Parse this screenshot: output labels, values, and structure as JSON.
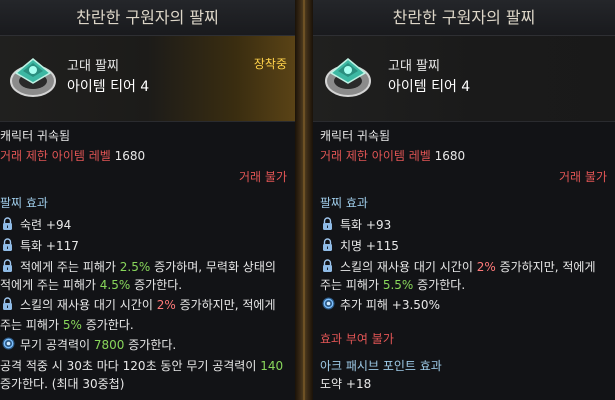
{
  "left": {
    "title": "찬란한 구원자의 팔찌",
    "grade": "고대 팔찌",
    "tier": "아이템 티어 4",
    "equipped": "장착중",
    "bound": "캐릭터 귀속됨",
    "trade_label": "거래 제한 아이템 레벨",
    "trade_value": "1680",
    "trade_status": "거래 불가",
    "section": "팔찌 효과",
    "effects": [
      {
        "text": "숙련 +94"
      },
      {
        "text": "특화 +117"
      },
      {
        "pre": "적에게 주는 피해가 ",
        "hl": "2.5%",
        "post": " 증가하며, 무력화 상태의",
        "line2_pre": "적에게 주는 피해가 ",
        "line2_hl": "4.5%",
        "line2_post": " 증가한다."
      },
      {
        "pre": "스킬의 재사용 대기 시간이 ",
        "hl": "2%",
        "post": " 증가하지만, 적에게",
        "line2_pre": "주는 피해가 ",
        "line2_hl": "5%",
        "line2_post": " 증가한다."
      },
      {
        "pre": "무기 공격력이 ",
        "hl": "7800",
        "post": " 증가한다."
      }
    ],
    "extra_line1_pre": "공격 적중 시 30초 마다 120초 동안 무기 공격력이 ",
    "extra_line1_hl": "140",
    "extra_line2": "증가한다. (최대 30중첩)"
  },
  "right": {
    "title": "찬란한 구원자의 팔찌",
    "grade": "고대 팔찌",
    "tier": "아이템 티어 4",
    "bound": "캐릭터 귀속됨",
    "trade_label": "거래 제한 아이템 레벨",
    "trade_value": "1680",
    "trade_status": "거래 불가",
    "section": "팔찌 효과",
    "effects": [
      {
        "text": "특화 +93"
      },
      {
        "text": "치명 +115"
      },
      {
        "pre": "스킬의 재사용 대기 시간이 ",
        "hl": "2%",
        "post": " 증가하지만, 적에게",
        "line2_pre": "주는 피해가 ",
        "line2_hl": "5.5%",
        "line2_post": " 증가한다."
      },
      {
        "text": "추가 피해 +3.50%"
      }
    ],
    "no_grant": "효과 부여 불가",
    "ark_section": "아크 패시브 포인트 효과",
    "ark_value": "도약 +18"
  },
  "icons": [
    "lock-icon",
    "gem-icon",
    "bracelet-icon"
  ]
}
